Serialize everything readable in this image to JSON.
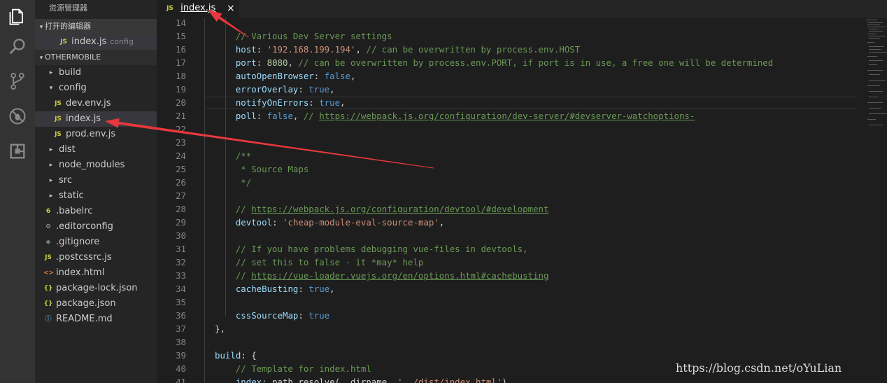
{
  "sidebar": {
    "title": "资源管理器",
    "open_editors": {
      "header": "打开的编辑器",
      "item": {
        "icon": "JS",
        "name": "index.js",
        "desc": "config"
      }
    },
    "project": {
      "header": "OTHERMOBILE",
      "items": [
        {
          "name": "build",
          "icon": "▸"
        },
        {
          "name": "config",
          "icon": "▾"
        },
        {
          "name": "dev.env.js",
          "icon": "JS"
        },
        {
          "name": "index.js",
          "icon": "JS"
        },
        {
          "name": "prod.env.js",
          "icon": "JS"
        },
        {
          "name": "dist",
          "icon": "▸"
        },
        {
          "name": "node_modules",
          "icon": "▸"
        },
        {
          "name": "src",
          "icon": "▸"
        },
        {
          "name": "static",
          "icon": "▸"
        },
        {
          "name": ".babelrc",
          "icon": "6"
        },
        {
          "name": ".editorconfig",
          "icon": "⚙"
        },
        {
          "name": ".gitignore",
          "icon": "◆"
        },
        {
          "name": ".postcssrc.js",
          "icon": "JS"
        },
        {
          "name": "index.html",
          "icon": "<>"
        },
        {
          "name": "package-lock.json",
          "icon": "{}"
        },
        {
          "name": "package.json",
          "icon": "{}"
        },
        {
          "name": "README.md",
          "icon": "ⓘ"
        }
      ]
    }
  },
  "tab": {
    "icon": "JS",
    "label": "index.js",
    "close": "×"
  },
  "editor": {
    "line_numbers": [
      "14",
      "15",
      "16",
      "17",
      "18",
      "19",
      "20",
      "21",
      "22",
      "23",
      "24",
      "25",
      "26",
      "27",
      "28",
      "29",
      "30",
      "31",
      "32",
      "33",
      "34",
      "35",
      "36",
      "37",
      "38",
      "39",
      "40",
      "41"
    ],
    "lines": [
      [],
      [
        [
          "c",
          "    // Various Dev Server settings"
        ]
      ],
      [
        [
          "t",
          "    "
        ],
        [
          "k",
          "host"
        ],
        [
          "t",
          ": "
        ],
        [
          "s",
          "'192.168.199.194'"
        ],
        [
          "t",
          ", "
        ],
        [
          "c",
          "// can be overwritten by process.env.HOST"
        ]
      ],
      [
        [
          "t",
          "    "
        ],
        [
          "k",
          "port"
        ],
        [
          "t",
          ": "
        ],
        [
          "n",
          "8080"
        ],
        [
          "t",
          ", "
        ],
        [
          "c",
          "// can be overwritten by process.env.PORT, if port is in use, a free one will be determined"
        ]
      ],
      [
        [
          "t",
          "    "
        ],
        [
          "k",
          "autoOpenBrowser"
        ],
        [
          "t",
          ": "
        ],
        [
          "b",
          "false"
        ],
        [
          "t",
          ","
        ]
      ],
      [
        [
          "t",
          "    "
        ],
        [
          "k",
          "errorOverlay"
        ],
        [
          "t",
          ": "
        ],
        [
          "b",
          "true"
        ],
        [
          "t",
          ","
        ]
      ],
      [
        [
          "t",
          "    "
        ],
        [
          "k",
          "notifyOnErrors"
        ],
        [
          "t",
          ": "
        ],
        [
          "b",
          "true"
        ],
        [
          "t",
          ","
        ]
      ],
      [
        [
          "t",
          "    "
        ],
        [
          "k",
          "poll"
        ],
        [
          "t",
          ": "
        ],
        [
          "b",
          "false"
        ],
        [
          "t",
          ", "
        ],
        [
          "c",
          "// "
        ],
        [
          "u",
          "https://webpack.js.org/configuration/dev-server/#devserver-watchoptions-"
        ]
      ],
      [],
      [],
      [
        [
          "c",
          "    /**"
        ]
      ],
      [
        [
          "c",
          "     * Source Maps"
        ]
      ],
      [
        [
          "c",
          "     */"
        ]
      ],
      [],
      [
        [
          "c",
          "    // "
        ],
        [
          "u",
          "https://webpack.js.org/configuration/devtool/#development"
        ]
      ],
      [
        [
          "t",
          "    "
        ],
        [
          "k",
          "devtool"
        ],
        [
          "t",
          ": "
        ],
        [
          "s",
          "'cheap-module-eval-source-map'"
        ],
        [
          "t",
          ","
        ]
      ],
      [],
      [
        [
          "c",
          "    // If you have problems debugging vue-files in devtools,"
        ]
      ],
      [
        [
          "c",
          "    // set this to false - it *may* help"
        ]
      ],
      [
        [
          "c",
          "    // "
        ],
        [
          "u",
          "https://vue-loader.vuejs.org/en/options.html#cachebusting"
        ]
      ],
      [
        [
          "t",
          "    "
        ],
        [
          "k",
          "cacheBusting"
        ],
        [
          "t",
          ": "
        ],
        [
          "b",
          "true"
        ],
        [
          "t",
          ","
        ]
      ],
      [],
      [
        [
          "t",
          "    "
        ],
        [
          "k",
          "cssSourceMap"
        ],
        [
          "t",
          ": "
        ],
        [
          "b",
          "true"
        ]
      ],
      [
        [
          "t",
          "},"
        ]
      ],
      [],
      [
        [
          "k",
          "build"
        ],
        [
          "t",
          ": {"
        ]
      ],
      [
        [
          "c",
          "    // Template for index.html"
        ]
      ],
      [
        [
          "t",
          "    "
        ],
        [
          "k",
          "index"
        ],
        [
          "t",
          ": path.resolve(__dirname, "
        ],
        [
          "s",
          "'../dist/index.html'"
        ],
        [
          "t",
          "),"
        ]
      ]
    ]
  },
  "watermark": "https://blog.csdn.net/oYuLian",
  "colors": {
    "arrow": "#e8383d",
    "accent": "#cbcb41"
  }
}
